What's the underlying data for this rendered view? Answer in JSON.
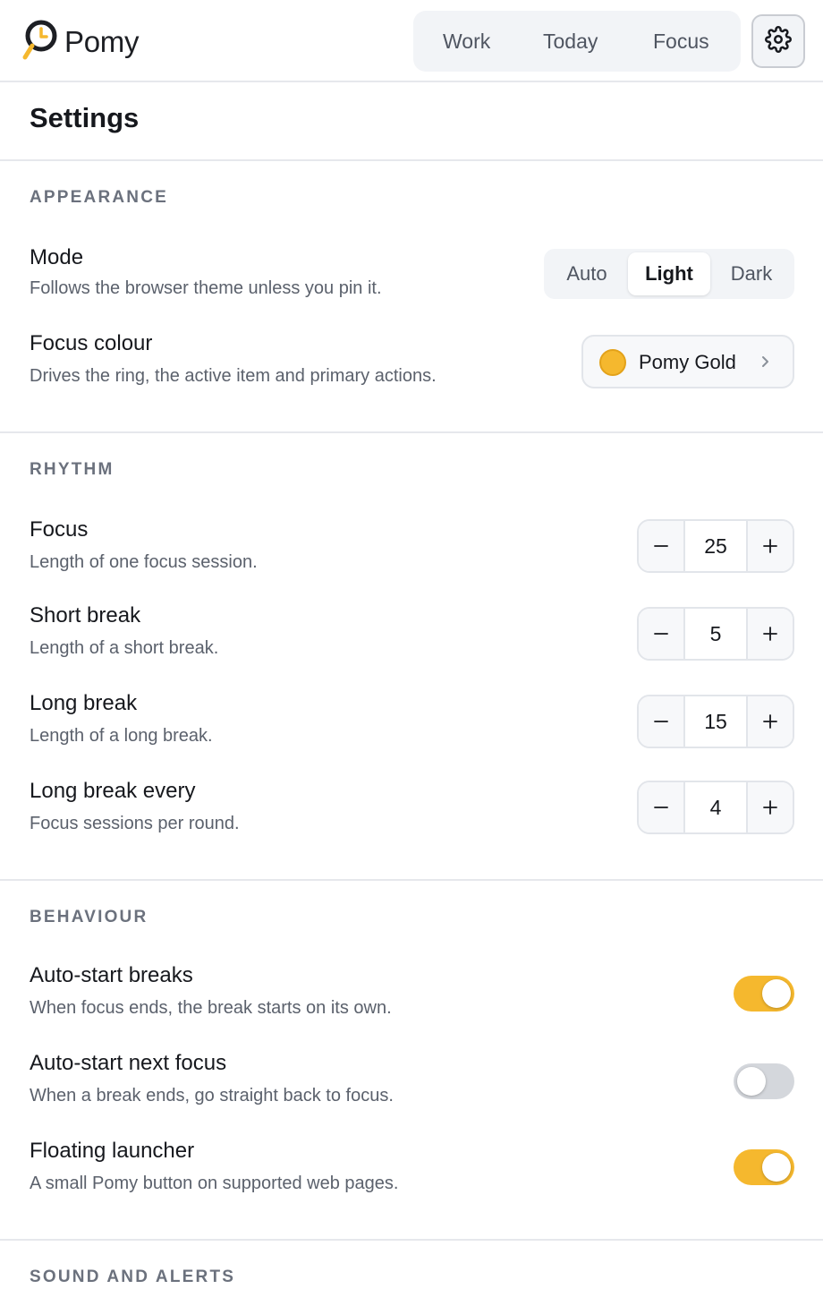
{
  "app": {
    "name": "Pomy"
  },
  "nav": {
    "tabs": [
      "Work",
      "Today",
      "Focus"
    ]
  },
  "page": {
    "title": "Settings"
  },
  "colors": {
    "accent": "#f5b82e",
    "toggle_off": "#d4d7dc"
  },
  "icons": {
    "logo": "pomy-logo-icon",
    "settings": "gear-icon",
    "minus": "minus-icon",
    "plus": "plus-icon",
    "chevron": "chevron-right-icon"
  },
  "appearance": {
    "title": "APPEARANCE",
    "mode": {
      "label": "Mode",
      "desc": "Follows the browser theme unless you pin it.",
      "options": [
        "Auto",
        "Light",
        "Dark"
      ],
      "selected": "Light"
    },
    "focus_colour": {
      "label": "Focus colour",
      "desc": "Drives the ring, the active item and primary actions.",
      "value": "Pomy Gold",
      "swatch": "#f5b82e"
    }
  },
  "rhythm": {
    "title": "RHYTHM",
    "items": [
      {
        "label": "Focus",
        "desc": "Length of one focus session.",
        "value": "25"
      },
      {
        "label": "Short break",
        "desc": "Length of a short break.",
        "value": "5"
      },
      {
        "label": "Long break",
        "desc": "Length of a long break.",
        "value": "15"
      },
      {
        "label": "Long break every",
        "desc": "Focus sessions per round.",
        "value": "4"
      }
    ]
  },
  "behaviour": {
    "title": "BEHAVIOUR",
    "items": [
      {
        "label": "Auto-start breaks",
        "desc": "When focus ends, the break starts on its own.",
        "on": true
      },
      {
        "label": "Auto-start next focus",
        "desc": "When a break ends, go straight back to focus.",
        "on": false
      },
      {
        "label": "Floating launcher",
        "desc": "A small Pomy button on supported web pages.",
        "on": true
      }
    ]
  },
  "sound": {
    "title": "SOUND AND ALERTS"
  }
}
